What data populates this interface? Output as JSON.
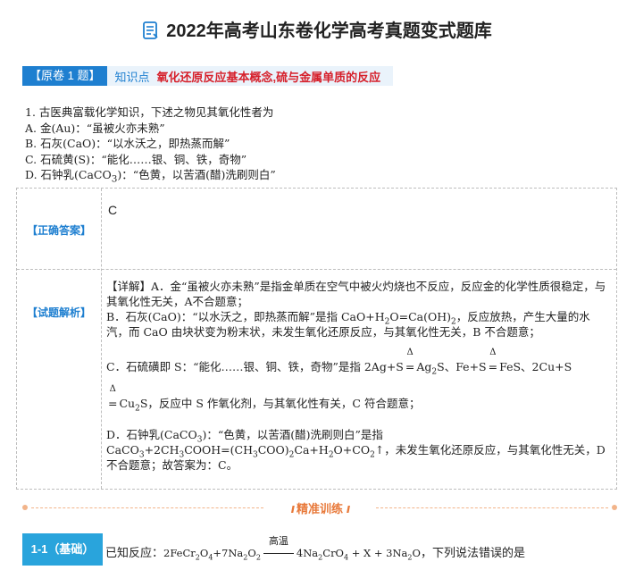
{
  "title": "2022年高考山东卷化学高考真题变式题库",
  "tag": {
    "original": "【原卷 1 题】",
    "knowledge_label": "知识点",
    "topic": "氧化还原反应基本概念,硫与金属单质的反应"
  },
  "question": {
    "stem": "1. 古医典富载化学知识，下述之物见其氧化性者为",
    "options": [
      "A. 金(Au)：“虽被火亦未熟”",
      "B. 石灰(CaO)：“以水沃之，即热蒸而解”",
      "C. 石硫黄(S)：“能化……银、铜、铁，奇物”",
      "D. 石钟乳(CaCO",
      "3",
      ")：“色黄，以苦酒(醋)洗刷则白”"
    ]
  },
  "answer": {
    "label": "【正确答案】",
    "value": "C"
  },
  "analysis": {
    "label": "【试题解析】",
    "p1": "【详解】A．金“虽被火亦未熟”是指金单质在空气中被火灼烧也不反应，反应金的化学性质很稳定，与其氧化性无关，A不合题意；",
    "p2a": "B．石灰(CaO)：“以水沃之，即热蒸而解”是指 CaO+H",
    "p2b": "2",
    "p2c": "O=Ca(OH)",
    "p2d": "2",
    "p2e": "，反应放热，产生大量的水汽，而 CaO 由块状变为粉末状，未发生氧化还原反应，与其氧化性无关，B 不合题意；",
    "p3a": "C．石硫磺即 S：“能化……银、铜、铁，奇物”是指 2Ag+S",
    "delta": "Δ",
    "p3b": "Ag",
    "p3c": "2",
    "p3d": "S、Fe+S",
    "p3e": "FeS、2Cu+S",
    "p4a": "Cu",
    "p4b": "2",
    "p4c": "S，反应中 S 作氧化剂，与其氧化性有关，C 符合题意；",
    "p5": "D．石钟乳(CaCO",
    "p5b": "3",
    "p5c": ")：“色黄，以苦酒(醋)洗刷则白”是指",
    "p6a": "CaCO",
    "p6b": "3",
    "p6c": "+2CH",
    "p6d": "3",
    "p6e": "COOH=(CH",
    "p6f": "3",
    "p6g": "COO)",
    "p6h": "2",
    "p6i": "Ca+H",
    "p6j": "2",
    "p6k": "O+CO",
    "p6l": "2",
    "p6m": "↑，未发生氧化还原反应，与其氧化性无关，D不合题意；故答案为：C。"
  },
  "banner": {
    "text": "精准训练",
    "chevrons_left": "//",
    "chevrons_right": "//"
  },
  "next_question": {
    "label": "1-1（基础）",
    "prefix": "已知反应：",
    "f1": "2FeCr",
    "f1s1": "2",
    "f1b": "O",
    "f1s2": "4",
    "f1c": "+7Na",
    "f1s3": "2",
    "f1d": "O",
    "f1s4": "2",
    "condition": "高温",
    "f2": "4Na",
    "f2s1": "2",
    "f2b": "CrO",
    "f2s2": "4",
    "f2c": " + X + 3Na",
    "f2s3": "2",
    "f2d": "O",
    "suffix": "，下列说法错误的是"
  },
  "colors": {
    "accent_blue": "#1e7fd0",
    "topic_red": "#d6202b",
    "banner_orange": "#e8793a",
    "label_bg": "#29a4dc"
  }
}
